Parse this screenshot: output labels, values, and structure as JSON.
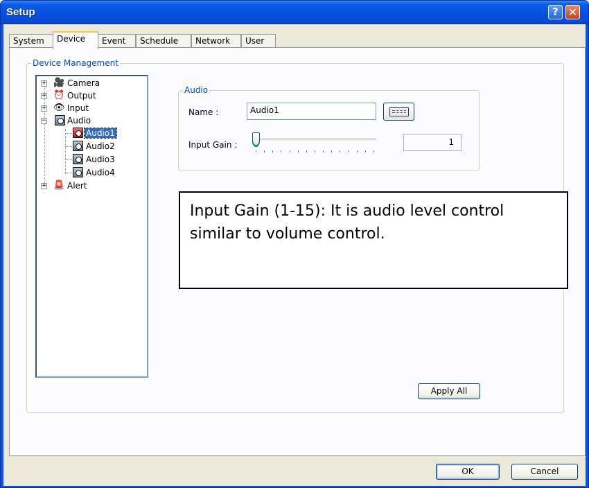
{
  "window": {
    "title": "Setup",
    "help_glyph": "?",
    "close_glyph": "✕"
  },
  "tabs": [
    "System",
    "Device",
    "Event",
    "Schedule",
    "Network",
    "User"
  ],
  "active_tab": "Device",
  "device_management": {
    "legend": "Device Management",
    "tree": {
      "camera": "Camera",
      "output": "Output",
      "input": "Input",
      "audio": "Audio",
      "audio_children": [
        "Audio1",
        "Audio2",
        "Audio3",
        "Audio4"
      ],
      "selected": "Audio1",
      "alert": "Alert"
    }
  },
  "audio_group": {
    "legend": "Audio",
    "name_label": "Name :",
    "name_value": "Audio1",
    "input_gain_label": "Input Gain :",
    "input_gain_value": "1",
    "input_gain_min": 1,
    "input_gain_max": 15
  },
  "annotation": {
    "text": "Input Gain (1-15): It is audio level control similar to volume control."
  },
  "buttons": {
    "apply_all": "Apply All",
    "ok": "OK",
    "cancel": "Cancel"
  },
  "colors": {
    "titlebar": "#0a55e4",
    "dialog_bg": "#ece9d8",
    "group_legend": "#0046d5",
    "selection": "#316ac5"
  }
}
